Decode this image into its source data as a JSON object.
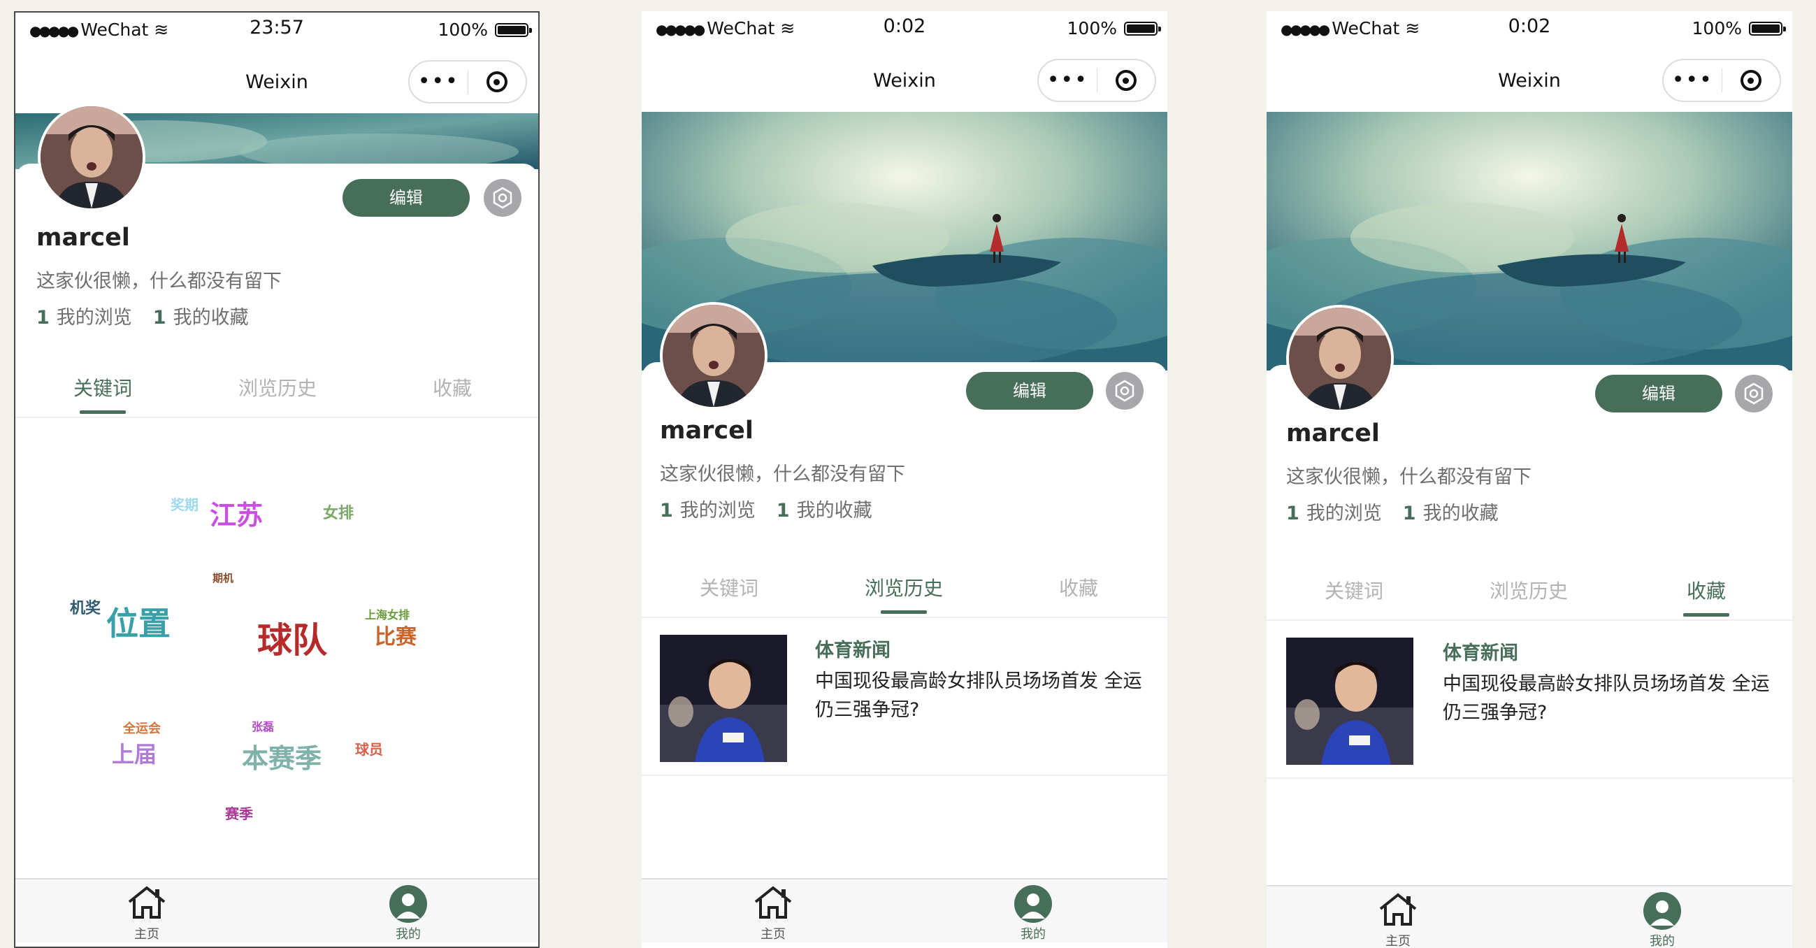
{
  "status_bar": {
    "carrier": "WeChat",
    "battery": "100%",
    "times": [
      "23:57",
      "0:02",
      "0:02"
    ]
  },
  "nav": {
    "title": "Weixin",
    "more_glyph": "•••"
  },
  "profile": {
    "username": "marcel",
    "bio": "这家伙很懒，什么都没有留下",
    "edit_label": "编辑",
    "browse_count": "1",
    "browse_label": "我的浏览",
    "fav_count": "1",
    "fav_label": "我的收藏"
  },
  "tabs": [
    "关键词",
    "浏览历史",
    "收藏"
  ],
  "active_tabs": [
    0,
    1,
    2
  ],
  "word_cloud": [
    {
      "text": "奖期",
      "color": "#9fd9ee"
    },
    {
      "text": "江苏",
      "color": "#c84fe0"
    },
    {
      "text": "女排",
      "color": "#7aa869"
    },
    {
      "text": "期机",
      "color": "#8a4a2a"
    },
    {
      "text": "机奖",
      "color": "#2f5a70"
    },
    {
      "text": "位置",
      "color": "#3aa0a8"
    },
    {
      "text": "球队",
      "color": "#b72a2a"
    },
    {
      "text": "上海女排",
      "color": "#6a9a3a"
    },
    {
      "text": "比赛",
      "color": "#c8652d"
    },
    {
      "text": "全运会",
      "color": "#d4763a"
    },
    {
      "text": "张磊",
      "color": "#b24ac6"
    },
    {
      "text": "上届",
      "color": "#b07ad8"
    },
    {
      "text": "本赛季",
      "color": "#7fb2aa"
    },
    {
      "text": "球员",
      "color": "#d8604a"
    },
    {
      "text": "赛季",
      "color": "#a83a9a"
    }
  ],
  "news_item": {
    "source": "体育新闻",
    "title": "中国现役最高龄女排队员场场首发 全运仍三强争冠?"
  },
  "tabbar": {
    "home_label": "主页",
    "home_icon": "home-icon",
    "me_label": "我的",
    "me_icon": "person-icon"
  },
  "colors": {
    "accent": "#476e58",
    "tab_inactive": "#b3b3b3",
    "settings_btn": "#a7a7ab"
  }
}
